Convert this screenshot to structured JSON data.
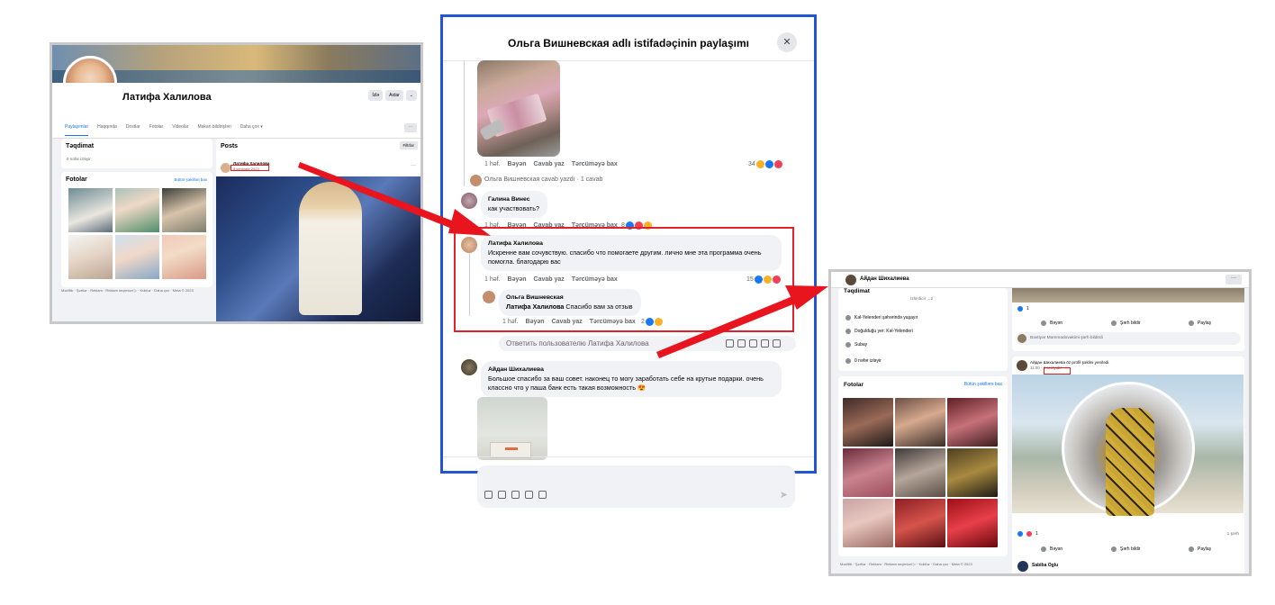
{
  "left_profile": {
    "name": "Латифа Халилова",
    "buttons": [
      "İzlə",
      "Axtar",
      "⌄"
    ],
    "tabs": [
      "Paylaşımlar",
      "Haqqında",
      "Dostlar",
      "Fotolar",
      "Videolar",
      "Məkan bildirişləri",
      "Daha çox ▾"
    ],
    "more": "···",
    "intro_title": "Təqdimat",
    "intro_item": "0 nəfər izləyir",
    "photos_title": "Fotolar",
    "photos_link": "Bütün şəkilləri bax",
    "posts_title": "Posts",
    "filters": "Filtrlər",
    "post_author": "Латифа Халилова",
    "post_time": "8 sentyabr 2023 ·",
    "post_more": "···",
    "footer": "Məxfilik · Şərtlər · Reklam · Reklam seçimləri ▷ · Kukilər · Daha çox · Meta © 2023"
  },
  "dialog": {
    "title": "Ольга Вишневская adlı istifadəçinin paylaşımı",
    "close_icon": "✕",
    "comments": [
      {
        "time": "1 həf.",
        "like": "Bəyən",
        "reply": "Cavab yaz",
        "translate": "Tərcüməyə bax",
        "reaction_count": "34"
      },
      {
        "replies_summary": "Ольга Вишневская cavab yazdı · 1 cavab"
      },
      {
        "author": "Галина Винес",
        "text": "как участвовать?",
        "time": "1 həf.",
        "like": "Bəyən",
        "reply": "Cavab yaz",
        "translate": "Tərcüməyə bax",
        "reaction_count": "8"
      },
      {
        "author": "Латифа Халилова",
        "text": "Искренне вам сочувствую. спасибо что помогаете другим. лично мне эта программа очень помогла. благодарю вас",
        "time": "1 həf.",
        "like": "Bəyən",
        "reply": "Cavab yaz",
        "translate": "Tərcüməyə bax",
        "reaction_count": "15"
      },
      {
        "author": "Ольга Вишневская",
        "mention": "Латифа Халилова",
        "text": " Спасибо вам за отзыв",
        "time": "1 həf.",
        "like": "Bəyən",
        "reply": "Cavab yaz",
        "translate": "Tərcüməyə bax",
        "reaction_count": "2"
      },
      {
        "reply_placeholder": "Ответить пользователю Латифа Халилова"
      },
      {
        "author": "Айдан Шихалиева",
        "text": "Большое спасибо за ваш совет. наконец то могу заработать себе на крутые подарки. очень классно что у паша банк есть такая возможность 😍"
      }
    ]
  },
  "composer": {
    "send_icon": "➤"
  },
  "right_profile": {
    "name": "Айдан Шихалиева",
    "more": "···",
    "intro_title": "Təqdimat",
    "followers_line": "İzlə'dicir ...2",
    "items": [
      "Kəl-Yelenderi şəhərində yaşayır",
      "Doğulduğu yer: Kəl-Yelenderi",
      "Subay",
      "0 nəfər izləyir"
    ],
    "photos_title": "Fotolar",
    "photos_link": "Bütün şəkillərə bax",
    "post_actions": [
      "Bəyən",
      "Şərh bildir",
      "Paylaş"
    ],
    "comment_line": "Bəxtiyar Məmmədovakimi şərh bildirdi",
    "reaction_count_top": "1",
    "post_author_line": "Айдан Шихалиева öz profil şəklini yenilədi.",
    "post_time": "11:00 · 3 sentyabr · ⚇",
    "reaction_count_bottom": "1",
    "shares": "1 şərh",
    "footer": "Məxfilik · Şərtlər · Reklam · Reklam seçimləri ▷ · Kukilər · Daha çox · Meta © 2023",
    "bottom_commenter": "Sabiba Oglu"
  }
}
